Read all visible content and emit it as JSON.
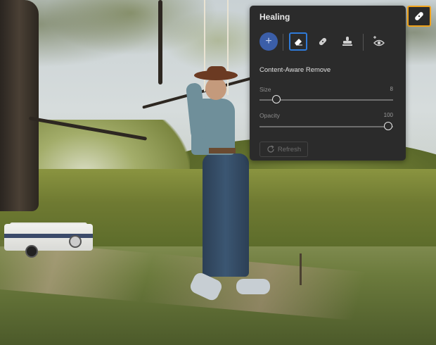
{
  "panel": {
    "title": "Healing",
    "mode_label": "Content-Aware Remove",
    "tools": {
      "add": "+",
      "remove_icon": "eraser-icon",
      "heal_icon": "bandage-icon",
      "clone_icon": "stamp-icon",
      "visibility_icon": "eye-plus-icon"
    },
    "size": {
      "label": "Size",
      "value": "8",
      "fraction": 0.1
    },
    "opacity": {
      "label": "Opacity",
      "value": "100",
      "fraction": 1.0
    },
    "refresh_label": "Refresh",
    "toggle_icon": "bandage-icon",
    "accent_color": "#f0a21a",
    "selection_color": "#2f7ad8"
  }
}
